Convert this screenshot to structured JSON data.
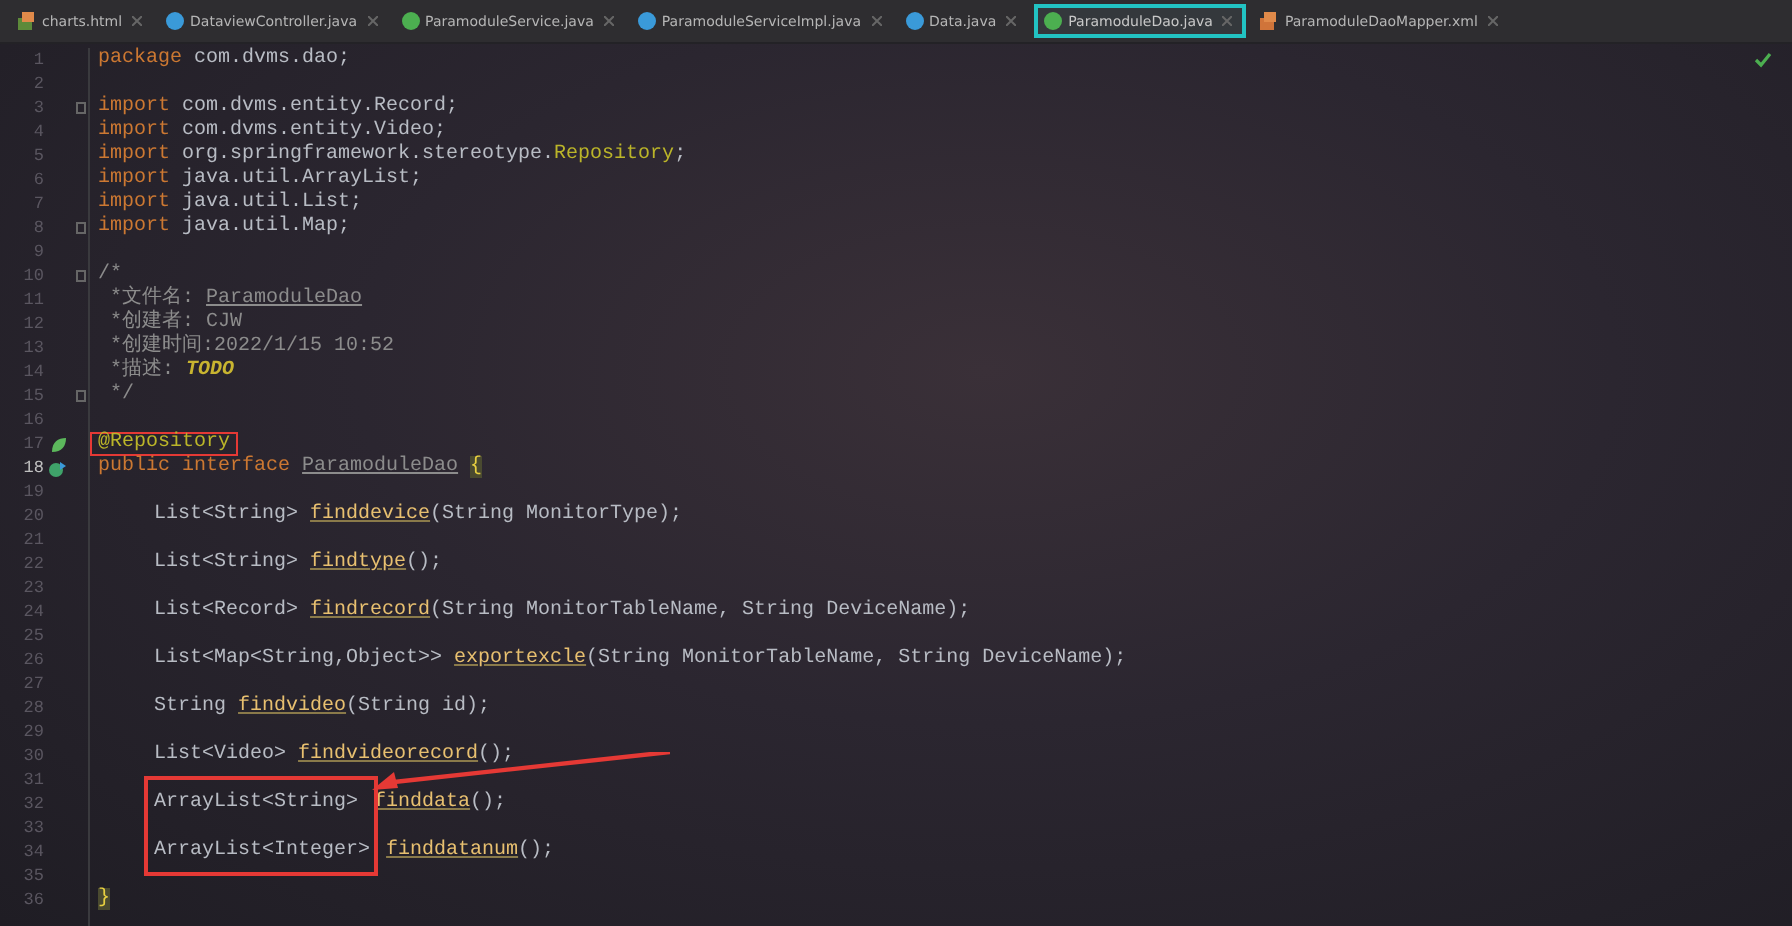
{
  "tabs": [
    {
      "label": "charts.html",
      "kind": "html",
      "selected": false
    },
    {
      "label": "DataviewController.java",
      "kind": "class",
      "selected": false
    },
    {
      "label": "ParamoduleService.java",
      "kind": "interface",
      "selected": false
    },
    {
      "label": "ParamoduleServiceImpl.java",
      "kind": "class",
      "selected": false
    },
    {
      "label": "Data.java",
      "kind": "class",
      "selected": false
    },
    {
      "label": "ParamoduleDao.java",
      "kind": "interface",
      "selected": true
    },
    {
      "label": "ParamoduleDaoMapper.xml",
      "kind": "xml",
      "selected": false
    }
  ],
  "editor": {
    "lines": [
      {
        "number": "1",
        "tokens": [
          {
            "kind": "keyword",
            "text": "package"
          },
          {
            "kind": "plain",
            "text": " com.dvms.dao;"
          }
        ]
      },
      {
        "number": "2"
      },
      {
        "number": "3",
        "fold": true,
        "tokens": [
          {
            "kind": "keyword",
            "text": "import"
          },
          {
            "kind": "plain",
            "text": " com.dvms.entity.Record;"
          }
        ]
      },
      {
        "number": "4",
        "tokens": [
          {
            "kind": "keyword",
            "text": "import"
          },
          {
            "kind": "plain",
            "text": " com.dvms.entity.Video;"
          }
        ]
      },
      {
        "number": "5",
        "tokens": [
          {
            "kind": "keyword",
            "text": "import"
          },
          {
            "kind": "plain",
            "text": " org.springframework.stereotype."
          },
          {
            "kind": "annotation",
            "text": "Repository"
          },
          {
            "kind": "plain",
            "text": ";"
          }
        ]
      },
      {
        "number": "6",
        "tokens": [
          {
            "kind": "keyword",
            "text": "import"
          },
          {
            "kind": "plain",
            "text": " java.util.ArrayList;"
          }
        ]
      },
      {
        "number": "7",
        "tokens": [
          {
            "kind": "keyword",
            "text": "import"
          },
          {
            "kind": "plain",
            "text": " java.util.List;"
          }
        ]
      },
      {
        "number": "8",
        "fold": true,
        "tokens": [
          {
            "kind": "keyword",
            "text": "import"
          },
          {
            "kind": "plain",
            "text": " java.util.Map;"
          }
        ]
      },
      {
        "number": "9"
      },
      {
        "number": "10",
        "fold": true,
        "tokens": [
          {
            "kind": "comment",
            "text": "/*"
          }
        ]
      },
      {
        "number": "11",
        "tokens": [
          {
            "kind": "comment",
            "text": " *文件名: "
          },
          {
            "kind": "comment-link",
            "text": "ParamoduleDao"
          }
        ]
      },
      {
        "number": "12",
        "tokens": [
          {
            "kind": "comment",
            "text": " *创建者: CJW"
          }
        ]
      },
      {
        "number": "13",
        "tokens": [
          {
            "kind": "comment",
            "text": " *创建时间:2022/1/15 10:52"
          }
        ]
      },
      {
        "number": "14",
        "tokens": [
          {
            "kind": "comment",
            "text": " *描述: "
          },
          {
            "kind": "todo",
            "text": "TODO"
          }
        ]
      },
      {
        "number": "15",
        "fold": true,
        "tokens": [
          {
            "kind": "comment",
            "text": " */"
          }
        ]
      },
      {
        "number": "16"
      },
      {
        "number": "17",
        "gutter": {
          "kind": "bean"
        },
        "tokens": [
          {
            "kind": "annotation",
            "text": "@Repository",
            "boxed": true
          }
        ]
      },
      {
        "number": "18",
        "gutter": {
          "kind": "implemented"
        },
        "current": true,
        "tokens": [
          {
            "kind": "keyword",
            "text": "public interface "
          },
          {
            "kind": "comment-link",
            "text": "ParamoduleDao"
          },
          {
            "kind": "brace",
            "text": "{"
          }
        ]
      },
      {
        "number": "19"
      },
      {
        "number": "20",
        "indented": true,
        "tokens": [
          {
            "kind": "plain",
            "text": "List<String> "
          },
          {
            "kind": "method",
            "text": "finddevice"
          },
          {
            "kind": "plain",
            "text": "(String MonitorType);"
          }
        ]
      },
      {
        "number": "21"
      },
      {
        "number": "22",
        "indented": true,
        "tokens": [
          {
            "kind": "plain",
            "text": "List<String> "
          },
          {
            "kind": "method",
            "text": "findtype"
          },
          {
            "kind": "plain",
            "text": "();"
          }
        ]
      },
      {
        "number": "23"
      },
      {
        "number": "24",
        "indented": true,
        "tokens": [
          {
            "kind": "plain",
            "text": "List<Record> "
          },
          {
            "kind": "method",
            "text": "findrecord"
          },
          {
            "kind": "plain",
            "text": "(String MonitorTableName, String DeviceName);"
          }
        ]
      },
      {
        "number": "25"
      },
      {
        "number": "26",
        "indented": true,
        "tokens": [
          {
            "kind": "plain",
            "text": "List<Map<String,Object>> "
          },
          {
            "kind": "method",
            "text": "exportexcle"
          },
          {
            "kind": "plain",
            "text": "(String MonitorTableName, String DeviceName);"
          }
        ]
      },
      {
        "number": "27"
      },
      {
        "number": "28",
        "indented": true,
        "tokens": [
          {
            "kind": "plain",
            "text": "String "
          },
          {
            "kind": "method",
            "text": "findvideo"
          },
          {
            "kind": "plain",
            "text": "(String id);"
          }
        ]
      },
      {
        "number": "29"
      },
      {
        "number": "30",
        "indented": true,
        "tokens": [
          {
            "kind": "plain",
            "text": "List<Video> "
          },
          {
            "kind": "method",
            "text": "findvideorecord"
          },
          {
            "kind": "plain",
            "text": "();"
          }
        ]
      },
      {
        "number": "31"
      },
      {
        "number": "32",
        "indented": true,
        "tokens": [
          {
            "kind": "plain",
            "text": "ArrayList<String>",
            "boxed": true
          },
          {
            "kind": "method",
            "text": "finddata",
            "pointed": true
          },
          {
            "kind": "plain",
            "text": "();"
          }
        ]
      },
      {
        "number": "33"
      },
      {
        "number": "34",
        "indented": true,
        "tokens": [
          {
            "kind": "plain",
            "text": "ArrayList<Integer>",
            "boxed": true
          },
          {
            "kind": "method",
            "text": "finddatanum"
          },
          {
            "kind": "plain",
            "text": "();"
          }
        ]
      },
      {
        "number": "35"
      },
      {
        "number": "36",
        "tokens": [
          {
            "kind": "brace",
            "text": "}"
          }
        ]
      }
    ]
  }
}
